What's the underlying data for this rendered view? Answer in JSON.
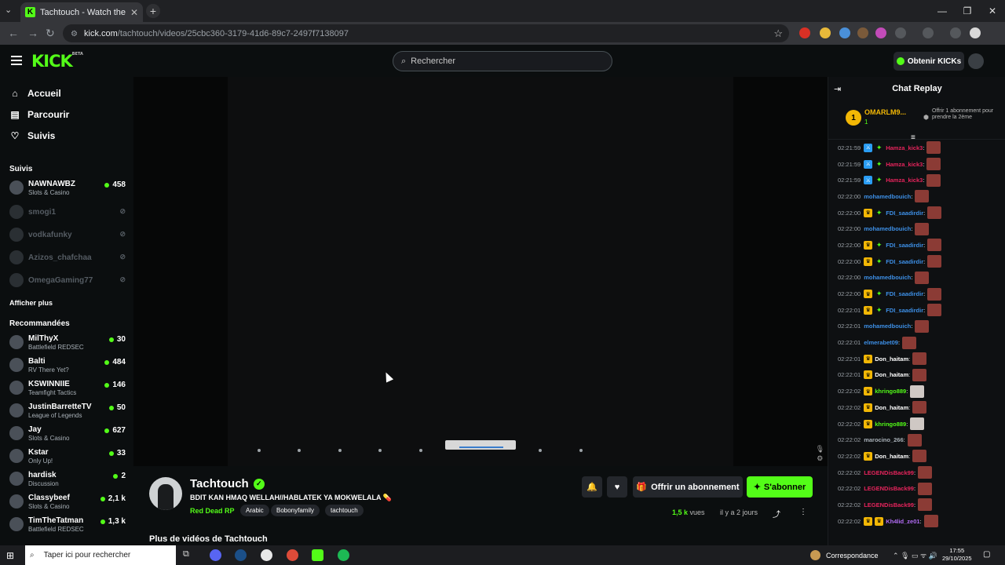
{
  "browser": {
    "tab_title": "Tachtouch - Watch the VOD",
    "tab_favicon": "K",
    "new_tab": "+",
    "url_host": "kick.com",
    "url_path": "/tachtouch/videos/25cbc360-3179-41d6-89c7-2497f7138097"
  },
  "header": {
    "logo": "KICK",
    "beta": "BETA",
    "search_placeholder": "Rechercher",
    "get_kicks": "Obtenir KICKs"
  },
  "sidebar": {
    "nav": [
      {
        "label": "Accueil",
        "icon": "home-icon"
      },
      {
        "label": "Parcourir",
        "icon": "browse-icon"
      },
      {
        "label": "Suivis",
        "icon": "heart-icon"
      }
    ],
    "following_title": "Suivis",
    "following": [
      {
        "name": "NAWNAWBZ",
        "category": "Slots & Casino",
        "viewers": "458"
      },
      {
        "name": "smogi1"
      },
      {
        "name": "vodkafunky"
      },
      {
        "name": "Azizos_chafchaa"
      },
      {
        "name": "OmegaGaming77"
      }
    ],
    "show_more": "Afficher plus",
    "recommended_title": "Recommandées",
    "recommended": [
      {
        "name": "MilThyX",
        "category": "Battlefield REDSEC",
        "viewers": "30"
      },
      {
        "name": "Balti",
        "category": "RV There Yet?",
        "viewers": "484"
      },
      {
        "name": "KSWINNIIE",
        "category": "Teamfight Tactics",
        "viewers": "146"
      },
      {
        "name": "JustinBarretteTV",
        "category": "League of Legends",
        "viewers": "50"
      },
      {
        "name": "Jay",
        "category": "Slots & Casino",
        "viewers": "627"
      },
      {
        "name": "Kstar",
        "category": "Only Up!",
        "viewers": "33"
      },
      {
        "name": "hardisk",
        "category": "Discussion",
        "viewers": "2"
      },
      {
        "name": "Classybeef",
        "category": "Slots & Casino",
        "viewers": "2,1 k"
      },
      {
        "name": "TimTheTatman",
        "category": "Battlefield REDSEC",
        "viewers": "1,3 k"
      }
    ]
  },
  "stream": {
    "streamer": "Tachtouch",
    "title": "BDIT KAN HMAQ WELLAH//HABLATEK YA MOKWELALA 💊",
    "game": "Red Dead RP",
    "tags": [
      "Arabic",
      "Bobonyfamily",
      "tachtouch"
    ],
    "gift_label": "Offrir un abonnement",
    "subscribe_label": "S'abonner",
    "views_count": "1,5 k",
    "views_label": "vues",
    "time_ago": "il y a 2 jours",
    "more_videos": "Plus de vidéos de Tachtouch"
  },
  "chat": {
    "title": "Chat Replay",
    "top_rank": "1",
    "top_user": "OMARLM9...",
    "top_count": "1",
    "gift_text": "Offrir 1 abonnement pour prendre la 2ème",
    "messages": [
      {
        "time": "02:21:59",
        "user": "Hamza_kick3",
        "color": "#e6245c",
        "badges": [
          "blue",
          "green"
        ],
        "emote": "red"
      },
      {
        "time": "02:21:59",
        "user": "Hamza_kick3",
        "color": "#e6245c",
        "badges": [
          "blue",
          "green"
        ],
        "emote": "red"
      },
      {
        "time": "02:21:59",
        "user": "Hamza_kick3",
        "color": "#e6245c",
        "badges": [
          "blue",
          "green"
        ],
        "emote": "red"
      },
      {
        "time": "02:22:00",
        "user": "mohamedbouich",
        "color": "#3d8fe6",
        "badges": [],
        "emote": "red"
      },
      {
        "time": "02:22:00",
        "user": "FDI_saadirdir",
        "color": "#3d8fe6",
        "badges": [
          "gold",
          "green"
        ],
        "emote": "red"
      },
      {
        "time": "02:22:00",
        "user": "mohamedbouich",
        "color": "#3d8fe6",
        "badges": [],
        "emote": "red"
      },
      {
        "time": "02:22:00",
        "user": "FDI_saadirdir",
        "color": "#3d8fe6",
        "badges": [
          "gold",
          "green"
        ],
        "emote": "red"
      },
      {
        "time": "02:22:00",
        "user": "FDI_saadirdir",
        "color": "#3d8fe6",
        "badges": [
          "gold",
          "green"
        ],
        "emote": "red"
      },
      {
        "time": "02:22:00",
        "user": "mohamedbouich",
        "color": "#3d8fe6",
        "badges": [],
        "emote": "red"
      },
      {
        "time": "02:22:00",
        "user": "FDI_saadirdir",
        "color": "#3d8fe6",
        "badges": [
          "gold",
          "green"
        ],
        "emote": "red"
      },
      {
        "time": "02:22:01",
        "user": "FDI_saadirdir",
        "color": "#3d8fe6",
        "badges": [
          "gold",
          "green"
        ],
        "emote": "red"
      },
      {
        "time": "02:22:01",
        "user": "mohamedbouich",
        "color": "#3d8fe6",
        "badges": [],
        "emote": "red"
      },
      {
        "time": "02:22:01",
        "user": "elmerabet09",
        "color": "#3d8fe6",
        "badges": [],
        "emote": "red"
      },
      {
        "time": "02:22:01",
        "user": "Don_haitam",
        "color": "#ffffff",
        "badges": [
          "gold"
        ],
        "emote": "red"
      },
      {
        "time": "02:22:01",
        "user": "Don_haitam",
        "color": "#ffffff",
        "badges": [
          "gold"
        ],
        "emote": "red"
      },
      {
        "time": "02:22:02",
        "user": "khringo889",
        "color": "#53fc18",
        "badges": [
          "gold"
        ],
        "emote": "light"
      },
      {
        "time": "02:22:02",
        "user": "Don_haitam",
        "color": "#ffffff",
        "badges": [
          "gold"
        ],
        "emote": "red"
      },
      {
        "time": "02:22:02",
        "user": "khringo889",
        "color": "#53fc18",
        "badges": [
          "gold"
        ],
        "emote": "light"
      },
      {
        "time": "02:22:02",
        "user": "marocino_266",
        "color": "#a8b0b7",
        "badges": [],
        "emote": "red"
      },
      {
        "time": "02:22:02",
        "user": "Don_haitam",
        "color": "#ffffff",
        "badges": [
          "gold"
        ],
        "emote": "red"
      },
      {
        "time": "02:22:02",
        "user": "LEGENDisBack99",
        "color": "#e6245c",
        "badges": [],
        "emote": "red"
      },
      {
        "time": "02:22:02",
        "user": "LEGENDisBack99",
        "color": "#e6245c",
        "badges": [],
        "emote": "red"
      },
      {
        "time": "02:22:02",
        "user": "LEGENDisBack99",
        "color": "#e6245c",
        "badges": [],
        "emote": "red"
      },
      {
        "time": "02:22:02",
        "user": "Kh4lid_ze01",
        "color": "#b26cf5",
        "badges": [
          "gold",
          "gold"
        ],
        "emote": "red"
      }
    ]
  },
  "taskbar": {
    "search_placeholder": "Taper ici pour rechercher",
    "weather": "Correspondance",
    "time": "17:55",
    "date": "29/10/2025"
  },
  "colors": {
    "accent": "#53fc18",
    "gold": "#f2b705"
  }
}
